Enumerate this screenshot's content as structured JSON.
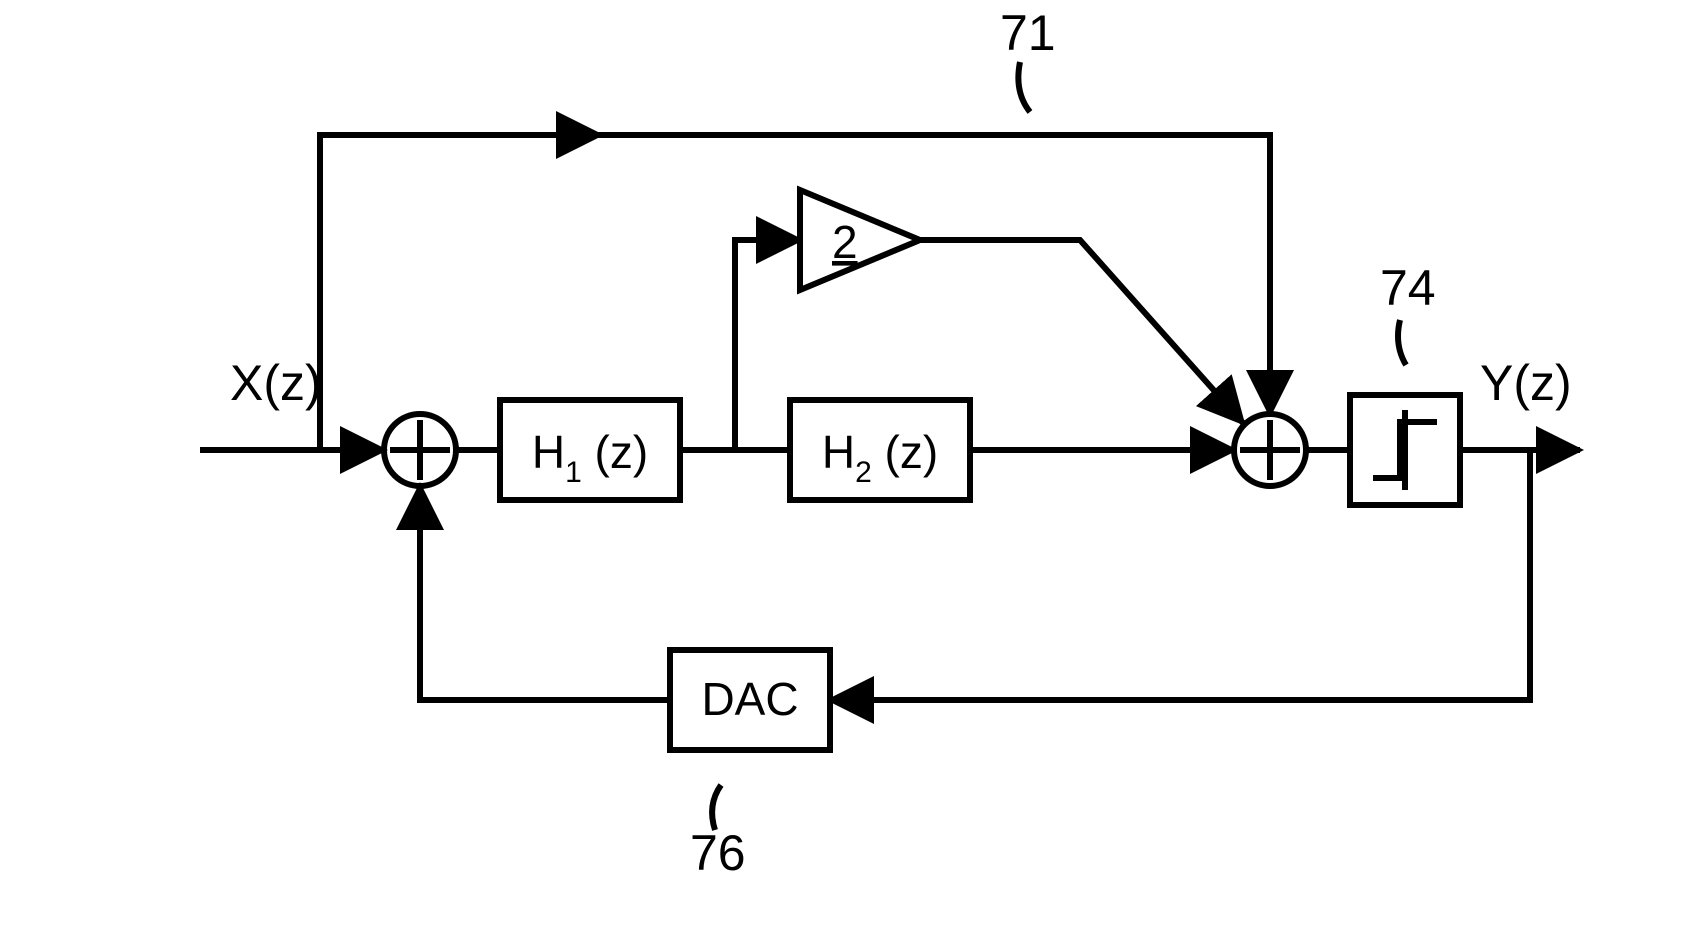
{
  "input_label": "X(z)",
  "output_label": "Y(z)",
  "gain_label": "2",
  "blocks": {
    "h1": {
      "label_main": "H",
      "label_sub": "1",
      "label_arg": " (z)"
    },
    "h2": {
      "label_main": "H",
      "label_sub": "2",
      "label_arg": " (z)"
    },
    "dac": "DAC"
  },
  "refs": {
    "feedforward": "71",
    "quantizer": "74",
    "dac": "76"
  }
}
